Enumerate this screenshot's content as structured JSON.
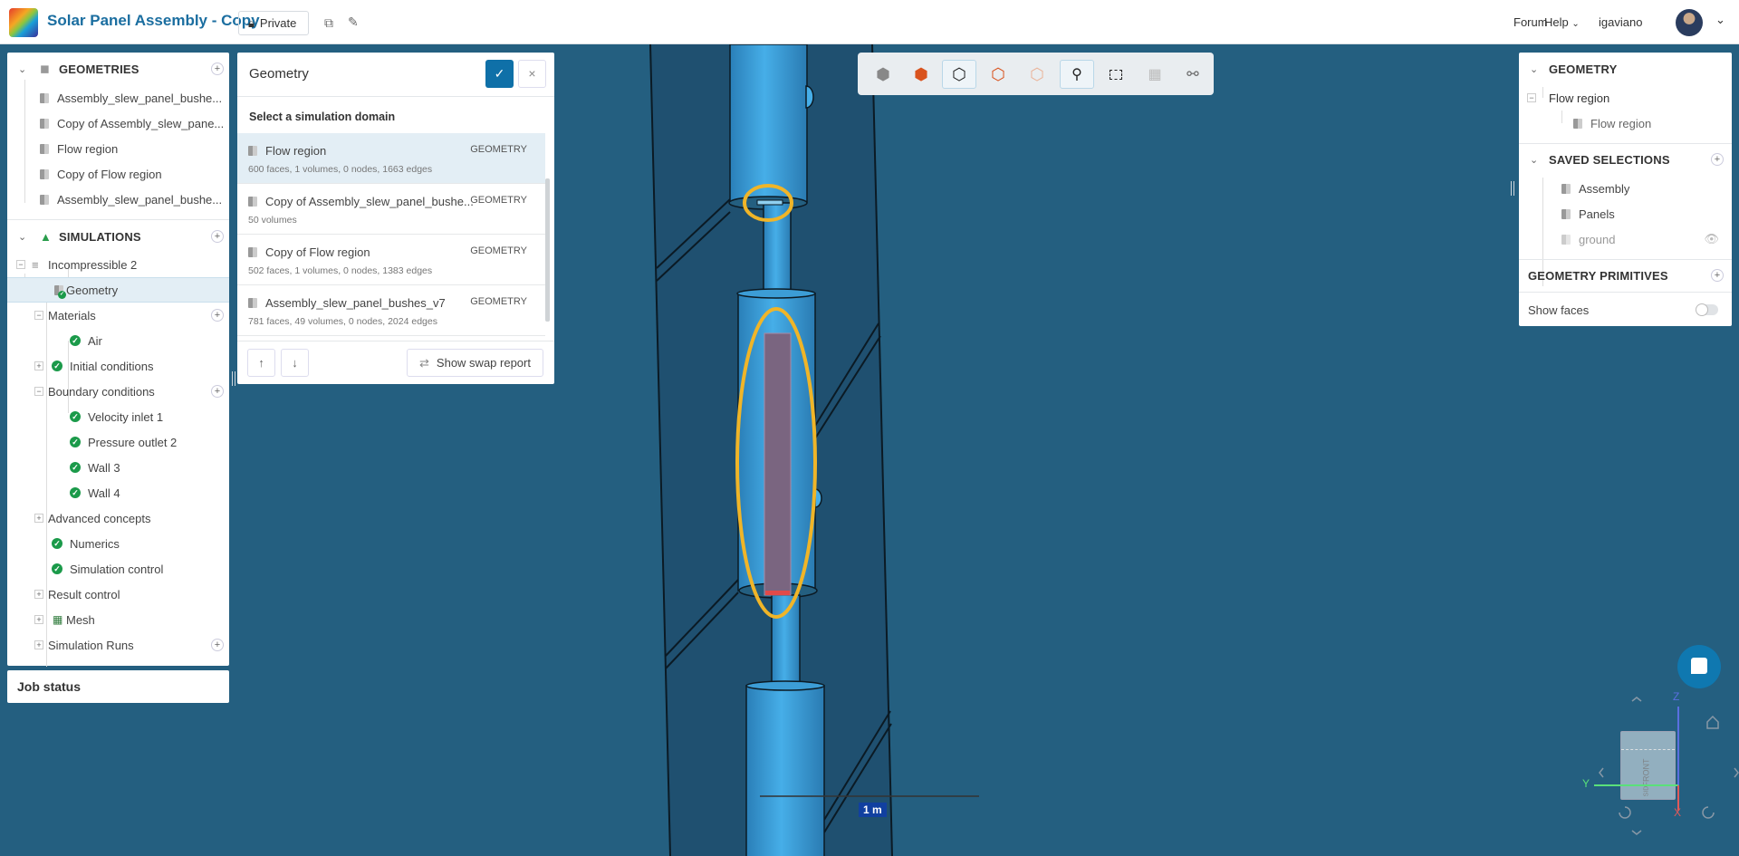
{
  "header": {
    "title": "Solar Panel Assembly - Copy",
    "privacy_label": "Private",
    "forum": "Forum",
    "help": "Help",
    "username": "igaviano"
  },
  "tree": {
    "geometries_title": "GEOMETRIES",
    "geometries": [
      "Assembly_slew_panel_bushe...",
      "Copy of Assembly_slew_pane...",
      "Flow region",
      "Copy of Flow region",
      "Assembly_slew_panel_bushe..."
    ],
    "simulations_title": "SIMULATIONS",
    "simulation": "Incompressible 2",
    "geometry": "Geometry",
    "materials": "Materials",
    "air": "Air",
    "initial_conditions": "Initial conditions",
    "boundary_conditions": "Boundary conditions",
    "bcs": [
      "Velocity inlet 1",
      "Pressure outlet 2",
      "Wall 3",
      "Wall 4"
    ],
    "advanced_concepts": "Advanced concepts",
    "numerics": "Numerics",
    "simulation_control": "Simulation control",
    "result_control": "Result control",
    "mesh": "Mesh",
    "simulation_runs": "Simulation Runs"
  },
  "job_status": "Job status",
  "geometry_panel": {
    "title": "Geometry",
    "subtitle": "Select a simulation domain",
    "items": [
      {
        "name": "Flow region",
        "details": "600 faces, 1 volumes, 0 nodes, 1663 edges",
        "type": "GEOMETRY"
      },
      {
        "name": "Copy of Assembly_slew_panel_bushe...",
        "details": "50 volumes",
        "type": "GEOMETRY"
      },
      {
        "name": "Copy of Flow region",
        "details": "502 faces, 1 volumes, 0 nodes, 1383 edges",
        "type": "GEOMETRY"
      },
      {
        "name": "Assembly_slew_panel_bushes_v7",
        "details": "781 faces, 49 volumes, 0 nodes, 2024 edges",
        "type": "GEOMETRY"
      }
    ],
    "swap_report": "Show swap report"
  },
  "right_panel": {
    "geometry_title": "GEOMETRY",
    "flow_region": "Flow region",
    "flow_region_child": "Flow region",
    "saved_selections_title": "SAVED SELECTIONS",
    "selections": [
      "Assembly",
      "Panels",
      "ground"
    ],
    "primitives_title": "GEOMETRY PRIMITIVES",
    "show_faces": "Show faces"
  },
  "viewer": {
    "scale_label": "1 m",
    "axis_x": "X",
    "axis_y": "Y",
    "axis_z": "Z",
    "cube_front": "FRONT",
    "cube_side": "SID"
  },
  "colors": {
    "accent": "#0f70a8",
    "background": "#245f80",
    "highlight": "#f0b528",
    "check": "#1b9a4a"
  }
}
